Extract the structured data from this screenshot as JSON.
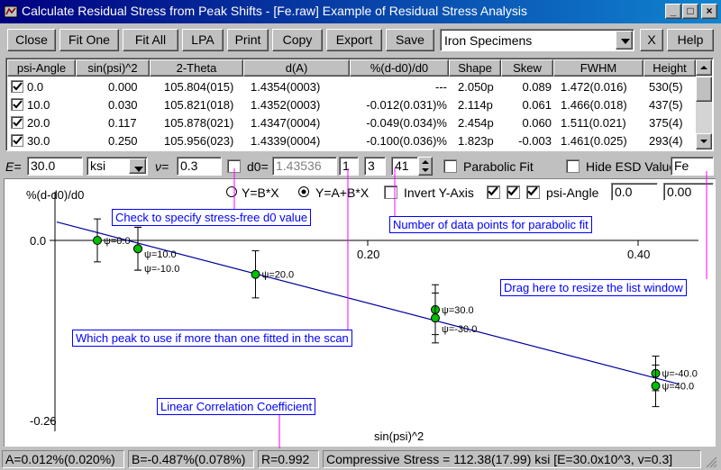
{
  "window": {
    "title": "Calculate Residual Stress from Peak Shifts - [Fe.raw]  Example of Residual Stress Analysis",
    "min_label": "_",
    "max_label": "□",
    "close_label": "×"
  },
  "toolbar": {
    "close": "Close",
    "fit_one": "Fit One",
    "fit_all": "Fit All",
    "lpa": "LPA",
    "print": "Print",
    "copy": "Copy",
    "export": "Export",
    "save": "Save",
    "specimen": "Iron Specimens",
    "x_label": "X",
    "help": "Help"
  },
  "table": {
    "columns": [
      "psi-Angle",
      "sin(psi)^2",
      "2-Theta",
      "d(A)",
      "%(d-d0)/d0",
      "Shape",
      "Skew",
      "FWHM",
      "Height"
    ],
    "rows": [
      {
        "psi": "0.0",
        "sin": "0.000",
        "two_theta": "105.804(015)",
        "d": "1.4354(0003)",
        "pct": "---",
        "shape": "2.050p",
        "skew": "0.089",
        "fwhm": "1.472(0.016)",
        "height": "530(5)"
      },
      {
        "psi": "10.0",
        "sin": "0.030",
        "two_theta": "105.821(018)",
        "d": "1.4352(0003)",
        "pct": "-0.012(0.031)%",
        "shape": "2.114p",
        "skew": "0.061",
        "fwhm": "1.466(0.018)",
        "height": "437(5)"
      },
      {
        "psi": "20.0",
        "sin": "0.117",
        "two_theta": "105.878(021)",
        "d": "1.4347(0004)",
        "pct": "-0.049(0.034)%",
        "shape": "2.454p",
        "skew": "0.060",
        "fwhm": "1.511(0.021)",
        "height": "375(4)"
      },
      {
        "psi": "30.0",
        "sin": "0.250",
        "two_theta": "105.956(023)",
        "d": "1.4339(0004)",
        "pct": "-0.100(0.036)%",
        "shape": "1.823p",
        "skew": "-0.003",
        "fwhm": "1.461(0.025)",
        "height": "293(4)"
      }
    ]
  },
  "params": {
    "e_label": "E=",
    "e_value": "30.0",
    "unit": "ksi",
    "nu_label": "ν=",
    "nu_value": "0.3",
    "d0_label": "d0=",
    "d0_value": "1.43536",
    "peak_index": "1",
    "order": "3",
    "points": "41",
    "parabolic_label": "Parabolic Fit",
    "hide_esd_label": "Hide ESD Values",
    "sample": "Fe"
  },
  "plot_controls": {
    "radio1": "Y=B*X",
    "radio2": "Y=A+B*X",
    "invert_label": "Invert Y-Axis",
    "psi_label": "psi-Angle",
    "field1": "0.0",
    "field2": "0.00"
  },
  "callouts": {
    "d0": "Check to specify stress-free d0 value",
    "points": "Number of data points for parabolic fit",
    "resize": "Drag here to resize the list window",
    "peak": "Which peak to use if more than one fitted in the scan",
    "corr": "Linear Correlation Coefficient"
  },
  "chart_data": {
    "type": "scatter",
    "ylabel": "%(d-d0)/d0",
    "xlabel": "sin(psi)^2",
    "x_ticks": [
      "0.20",
      "0.40"
    ],
    "y_ticks": [
      "0.0",
      "-0.26"
    ],
    "xlim": [
      -0.03,
      0.44
    ],
    "ylim": [
      -0.26,
      0.0
    ],
    "fit_line": {
      "x": [
        -0.03,
        0.43
      ],
      "y": [
        0.0266,
        -0.2074
      ]
    },
    "points": [
      {
        "x": 0.0,
        "y": 0.0,
        "err": 0.031,
        "label": "ψ=0.0"
      },
      {
        "x": 0.03,
        "y": -0.012,
        "err": 0.031,
        "label": "ψ=10.0"
      },
      {
        "x": 0.03,
        "y": -0.012,
        "err": 0.031,
        "label": "ψ=-10.0"
      },
      {
        "x": 0.117,
        "y": -0.049,
        "err": 0.034,
        "label": "ψ=20.0"
      },
      {
        "x": 0.25,
        "y": -0.1,
        "err": 0.036,
        "label": "ψ=30.0"
      },
      {
        "x": 0.25,
        "y": -0.112,
        "err": 0.036,
        "label": "ψ=-30.0"
      },
      {
        "x": 0.413,
        "y": -0.192,
        "err": 0.025,
        "label": "ψ=-40.0"
      },
      {
        "x": 0.413,
        "y": -0.21,
        "err": 0.03,
        "label": "ψ=40.0"
      }
    ]
  },
  "status": {
    "a": "A=0.012%(0.020%)",
    "b": "B=-0.487%(0.078%)",
    "r": "R=0.992",
    "stress": "Compressive Stress = 112.38(17.99) ksi [E=30.0x10^3, v=0.3]"
  },
  "colors": {
    "title_bar": "#000080",
    "fit_line": "#0000a0",
    "point_fill": "#00c000",
    "callout": "#0000ff",
    "leader": "#ff00ff"
  }
}
